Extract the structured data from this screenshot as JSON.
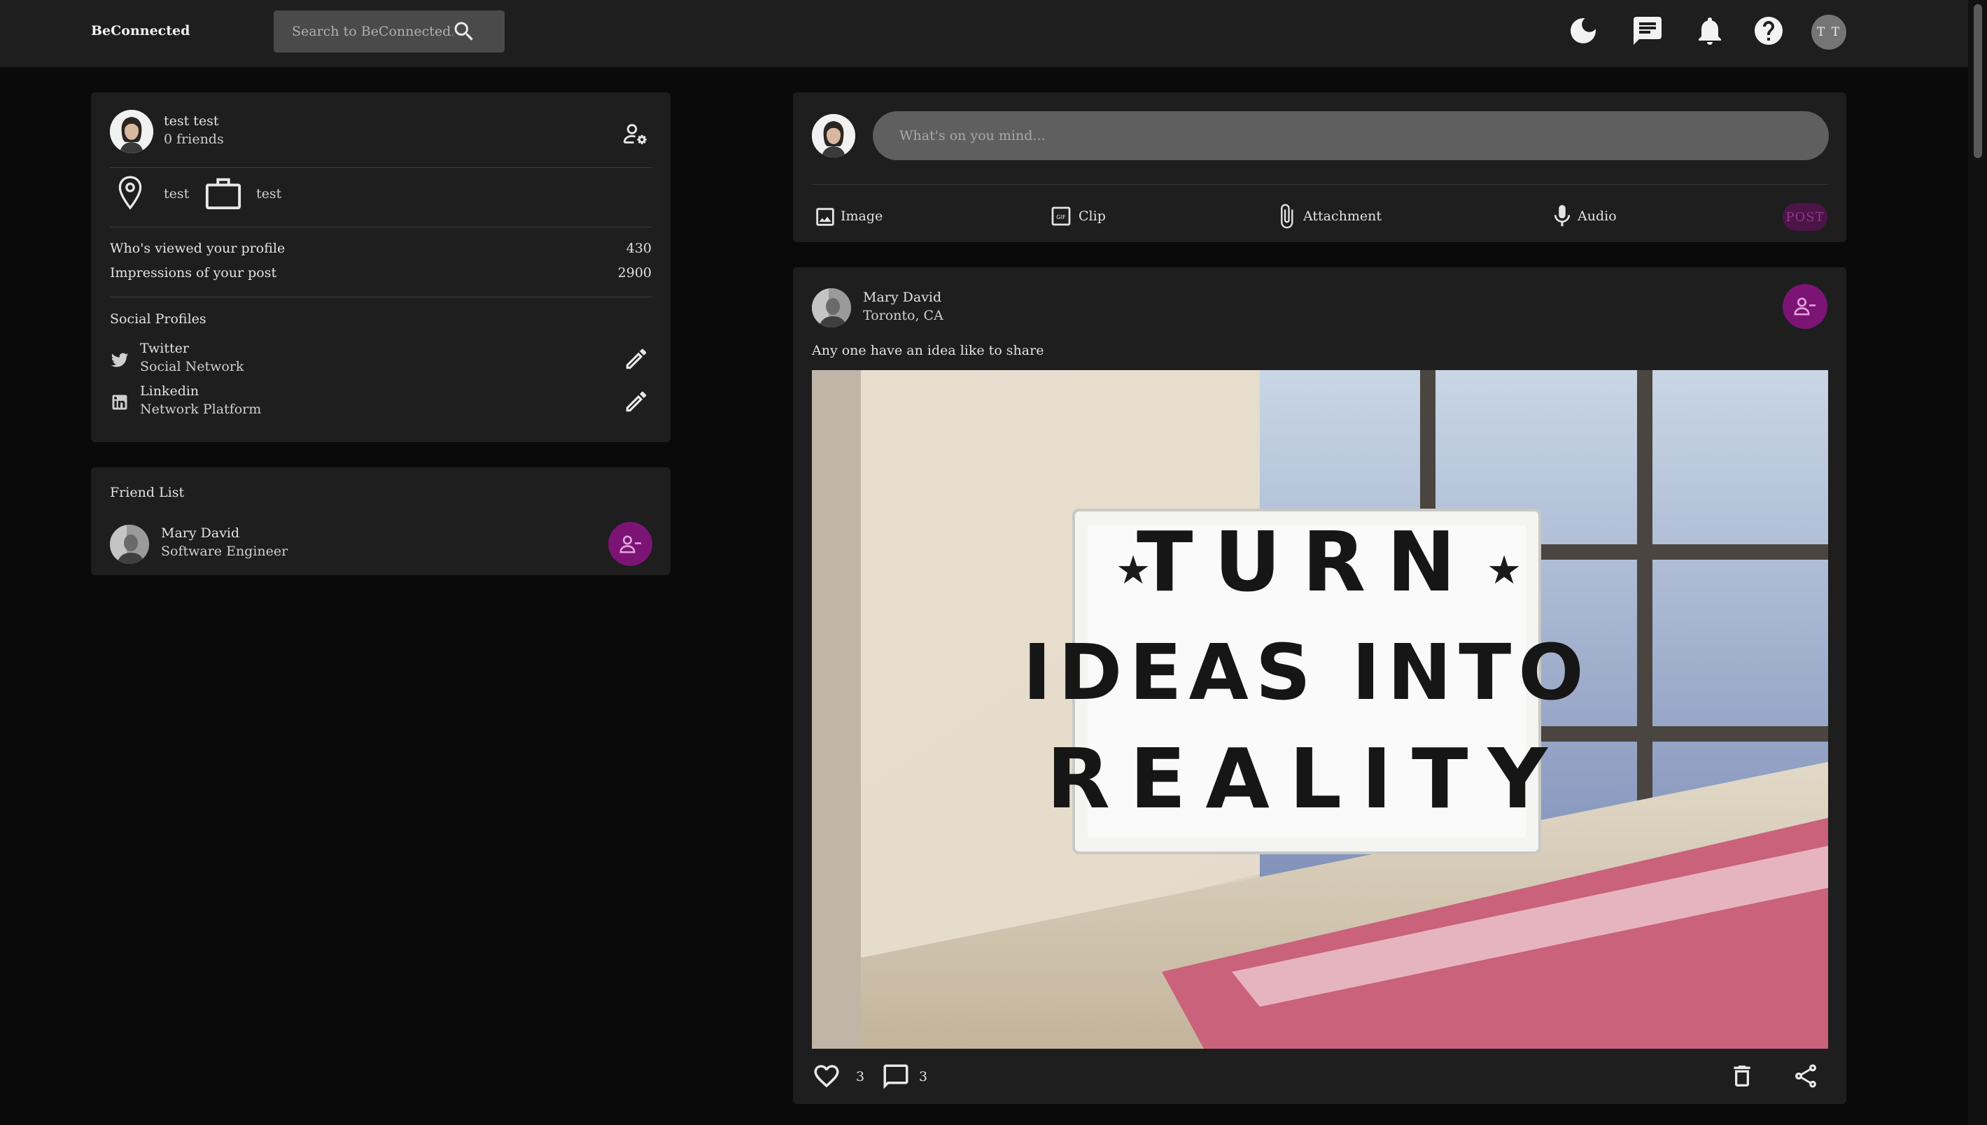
{
  "navbar": {
    "brand": "BeConnected",
    "search_placeholder": "Search to BeConnected...",
    "user_initials": "T T"
  },
  "profile": {
    "name": "test test",
    "friends": "0 friends",
    "location": "test",
    "occupation": "test",
    "stats": [
      {
        "label": "Who's viewed your profile",
        "value": "430"
      },
      {
        "label": "Impressions of your post",
        "value": "2900"
      }
    ],
    "social_title": "Social Profiles",
    "socials": [
      {
        "name": "Twitter",
        "desc": "Social Network",
        "icon": "twitter-icon"
      },
      {
        "name": "Linkedin",
        "desc": "Network Platform",
        "icon": "linkedin-icon"
      }
    ]
  },
  "friend_list": {
    "title": "Friend List",
    "friends": [
      {
        "name": "Mary David",
        "role": "Software Engineer"
      }
    ]
  },
  "composer": {
    "placeholder": "What's on you mind...",
    "actions": [
      {
        "label": "Image",
        "icon": "image-icon"
      },
      {
        "label": "Clip",
        "icon": "gif-icon"
      },
      {
        "label": "Attachment",
        "icon": "paperclip-icon"
      },
      {
        "label": "Audio",
        "icon": "microphone-icon"
      }
    ],
    "post_label": "POST"
  },
  "post": {
    "author": "Mary David",
    "location": "Toronto, CA",
    "text": "Any one have an idea like to share",
    "sign_lines": [
      "TURN",
      "IDEAS INTO",
      "REALITY"
    ],
    "likes": "3",
    "comments": "3"
  },
  "colors": {
    "background": "#0a0a0a",
    "card": "#1e1e1e",
    "accent": "#7b1475"
  }
}
